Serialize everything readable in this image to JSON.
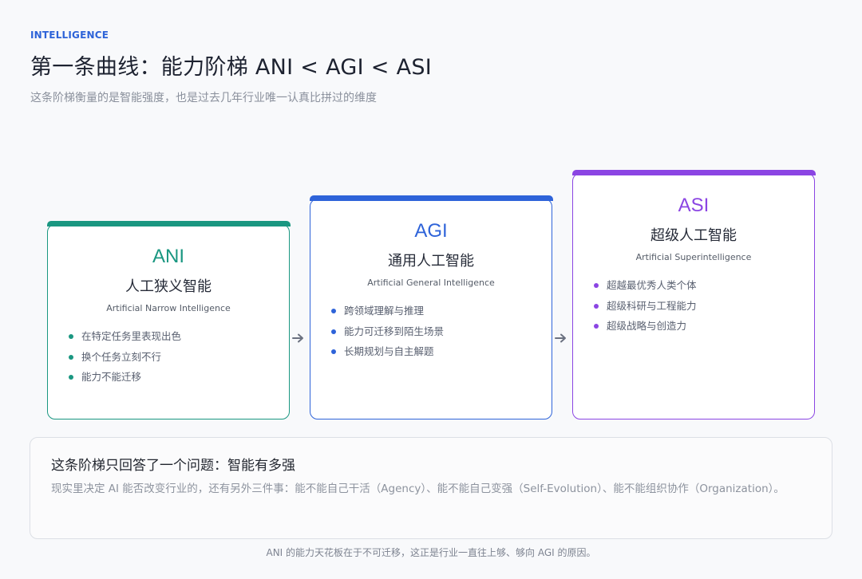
{
  "header": {
    "eyebrow": "INTELLIGENCE",
    "title": "第一条曲线：能力阶梯 ANI < AGI < ASI",
    "subtitle": "这条阶梯衡量的是智能强度，也是过去几年行业唯一认真比拼过的维度"
  },
  "cards": [
    {
      "code": "ANI",
      "cn": "人工狭义智能",
      "en": "Artificial Narrow Intelligence",
      "color": "#1a9781",
      "bullets": [
        "在特定任务里表现出色",
        "换个任务立刻不行",
        "能力不能迁移"
      ]
    },
    {
      "code": "AGI",
      "cn": "通用人工智能",
      "en": "Artificial General Intelligence",
      "color": "#2e63d9",
      "bullets": [
        "跨领域理解与推理",
        "能力可迁移到陌生场景",
        "长期规划与自主解题"
      ]
    },
    {
      "code": "ASI",
      "cn": "超级人工智能",
      "en": "Artificial Superintelligence",
      "color": "#8b45e3",
      "bullets": [
        "超越最优秀人类个体",
        "超级科研与工程能力",
        "超级战略与创造力"
      ]
    }
  ],
  "arrow_color": "#6b7180",
  "summary": {
    "title": "这条阶梯只回答了一个问题：智能有多强",
    "body": "现实里决定 AI 能否改变行业的，还有另外三件事：能不能自己干活（Agency）、能不能自己变强（Self-Evolution）、能不能组织协作（Organization）。"
  },
  "footnote": "ANI 的能力天花板在于不可迁移，这正是行业一直往上够、够向 AGI 的原因。"
}
